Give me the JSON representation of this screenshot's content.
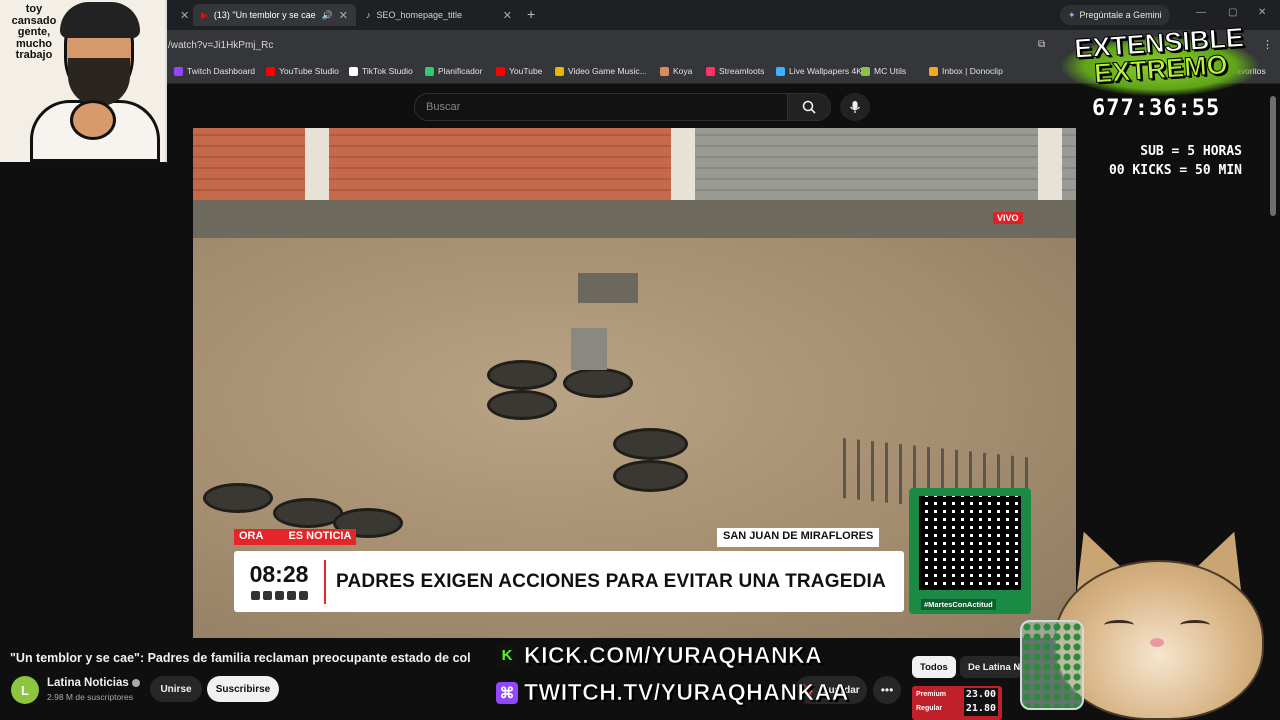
{
  "browser": {
    "tabs": [
      {
        "title": "(13) \"Un temblor y se cae\": ",
        "active": true
      },
      {
        "title": "SEO_homepage_title",
        "active": false
      }
    ],
    "gemini_label": "Pregúntale a Gemini",
    "url": "/watch?v=Ji1HkPmj_Rc",
    "bookmarks": [
      {
        "label": "Twitch Dashboard",
        "color": "#9146ff"
      },
      {
        "label": "YouTube Studio",
        "color": "#ff0000"
      },
      {
        "label": "TikTok Studio",
        "color": "#ffffff"
      },
      {
        "label": "Planificador",
        "color": "#2ecc71"
      },
      {
        "label": "YouTube",
        "color": "#ff0000"
      },
      {
        "label": "Video Game Music...",
        "color": "#e6b800"
      },
      {
        "label": "Koya",
        "color": "#d98c5f"
      },
      {
        "label": "Streamloots",
        "color": "#ff3366"
      },
      {
        "label": "Live Wallpapers 4K",
        "color": "#3fb0ff"
      },
      {
        "label": "MC Utils",
        "color": "#8bc34a"
      },
      {
        "label": "Inbox | Donoclip",
        "color": "#f5a623"
      }
    ],
    "bookmarks_overflow": "avoritos"
  },
  "youtube": {
    "search_placeholder": "Buscar",
    "video_title": "\"Un temblor y se cae\": Padres de familia reclaman preocupante estado de col",
    "channel_name": "Latina Noticias",
    "channel_initial": "L",
    "subscribers": "2.98 M de suscriptores",
    "join_label": "Unirse",
    "subscribe_label": "Suscribirse",
    "save_label": "Guardar",
    "chips": [
      "Todos",
      "De Latina N"
    ]
  },
  "video": {
    "live_badge": "VIVO",
    "tag_left": "ORA",
    "tag_news": "ES NOTICIA",
    "location": "SAN JUAN DE MIRAFLORES",
    "time": "08:28",
    "headline": "PADRES EXIGEN ACCIONES PARA EVITAR UNA TRAGEDIA",
    "qr_hashtag": "#MartesConActitud"
  },
  "stream": {
    "cam_caption": "toy cansado gente, mucho trabajo",
    "title_line1": "EXTENSIBLE",
    "title_line2": "EXTREMO",
    "timer": "677:36:55",
    "rule1": "SUB = 5 HORAS",
    "rule2": "00 KICKS = 50 MIN",
    "kick_url": "KICK.COM/YURAQHANKA",
    "twitch_url": "TWITCH.TV/YURAQHANKAA",
    "gas_premium_label": "Premium",
    "gas_premium_price": "23.00",
    "gas_regular_label": "Regular",
    "gas_regular_price": "21.80"
  }
}
